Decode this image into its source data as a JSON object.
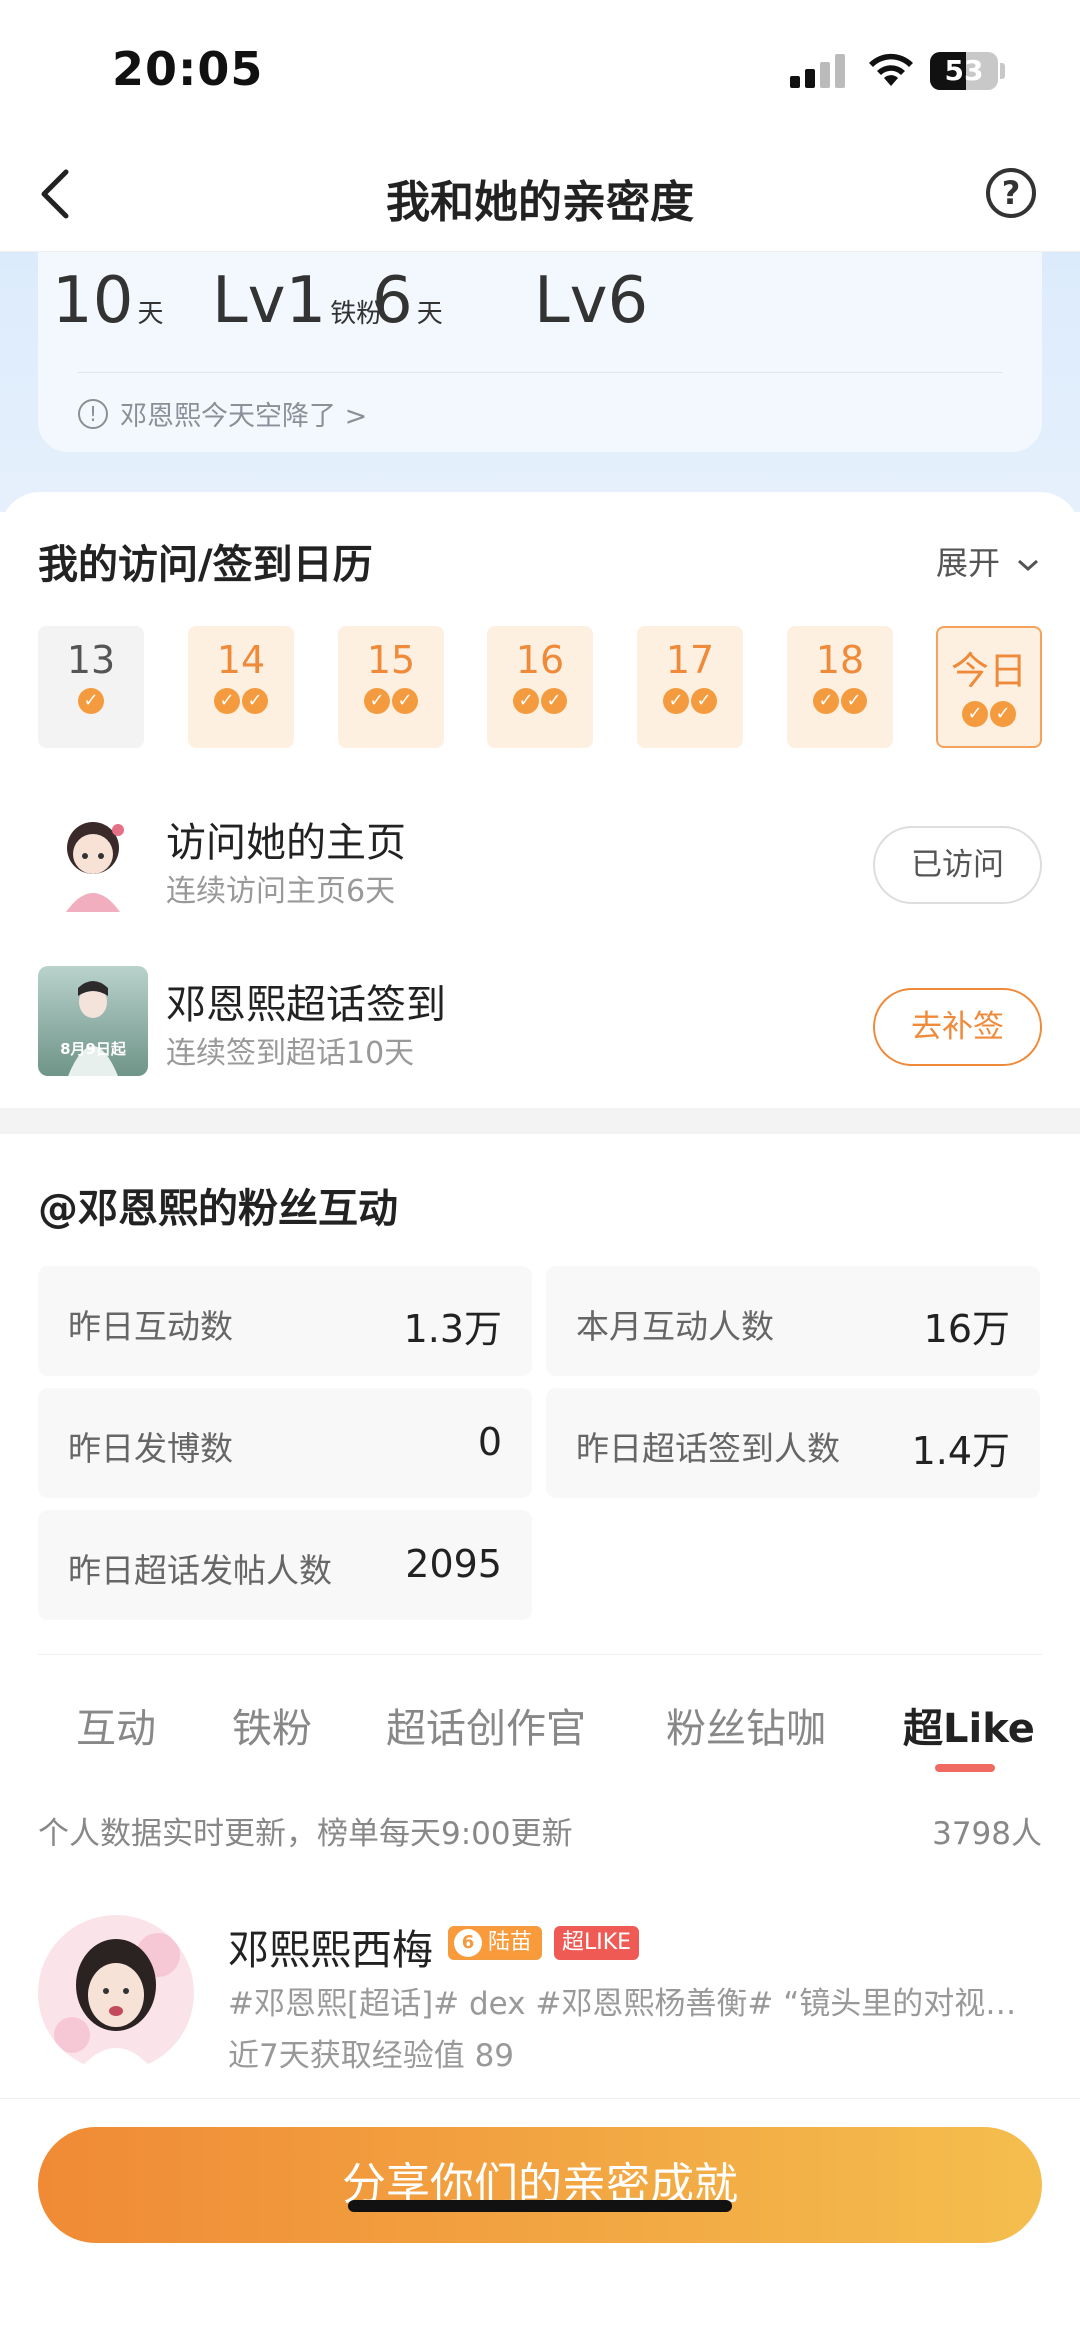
{
  "status": {
    "time": "20:05",
    "battery": "53"
  },
  "nav": {
    "title": "我和她的亲密度",
    "help": "?"
  },
  "stats": {
    "items": [
      {
        "value": "10",
        "unit": "天"
      },
      {
        "value": "Lv1",
        "unit": "铁粉"
      },
      {
        "value": "6",
        "unit": "天"
      },
      {
        "value": "Lv6",
        "unit": ""
      }
    ],
    "notice": "邓恩熙今天空降了 >",
    "notice_icon": "!"
  },
  "calendar": {
    "title": "我的访问/签到日历",
    "expand_label": "展开",
    "days": [
      {
        "label": "13",
        "checks": 1
      },
      {
        "label": "14",
        "checks": 2
      },
      {
        "label": "15",
        "checks": 2
      },
      {
        "label": "16",
        "checks": 2
      },
      {
        "label": "17",
        "checks": 2
      },
      {
        "label": "18",
        "checks": 2
      },
      {
        "label": "今日",
        "checks": 2
      }
    ],
    "tasks": [
      {
        "title": "访问她的主页",
        "sub": "连续访问主页6天",
        "button": "已访问"
      },
      {
        "title": "邓恩熙超话签到",
        "sub": "连续签到超话10天",
        "button": "去补签",
        "poster_text": "8月9日起"
      }
    ]
  },
  "interaction": {
    "title": "@邓恩熙的粉丝互动",
    "cells": [
      {
        "label": "昨日互动数",
        "value": "1.3万"
      },
      {
        "label": "本月互动人数",
        "value": "16万"
      },
      {
        "label": "昨日发博数",
        "value": "0"
      },
      {
        "label": "昨日超话签到人数",
        "value": "1.4万"
      },
      {
        "label": "昨日超话发帖人数",
        "value": "2095"
      }
    ]
  },
  "tabs": [
    "互动",
    "铁粉",
    "超话创作官",
    "粉丝钻咖",
    "超Like"
  ],
  "ranking": {
    "note": "个人数据实时更新，榜单每天9:00更新",
    "count": "3798人",
    "user": {
      "name": "邓熙熙西梅",
      "badge_level": "6",
      "badge_text": "陆苗",
      "badge2_text": "超LIKE",
      "desc": "#邓恩熙[超话]# dex #邓恩熙杨善衡# “镜头里的对视…",
      "exp": "近7天获取经验值 89"
    }
  },
  "footer": {
    "share_label": "分享你们的亲密成就"
  }
}
